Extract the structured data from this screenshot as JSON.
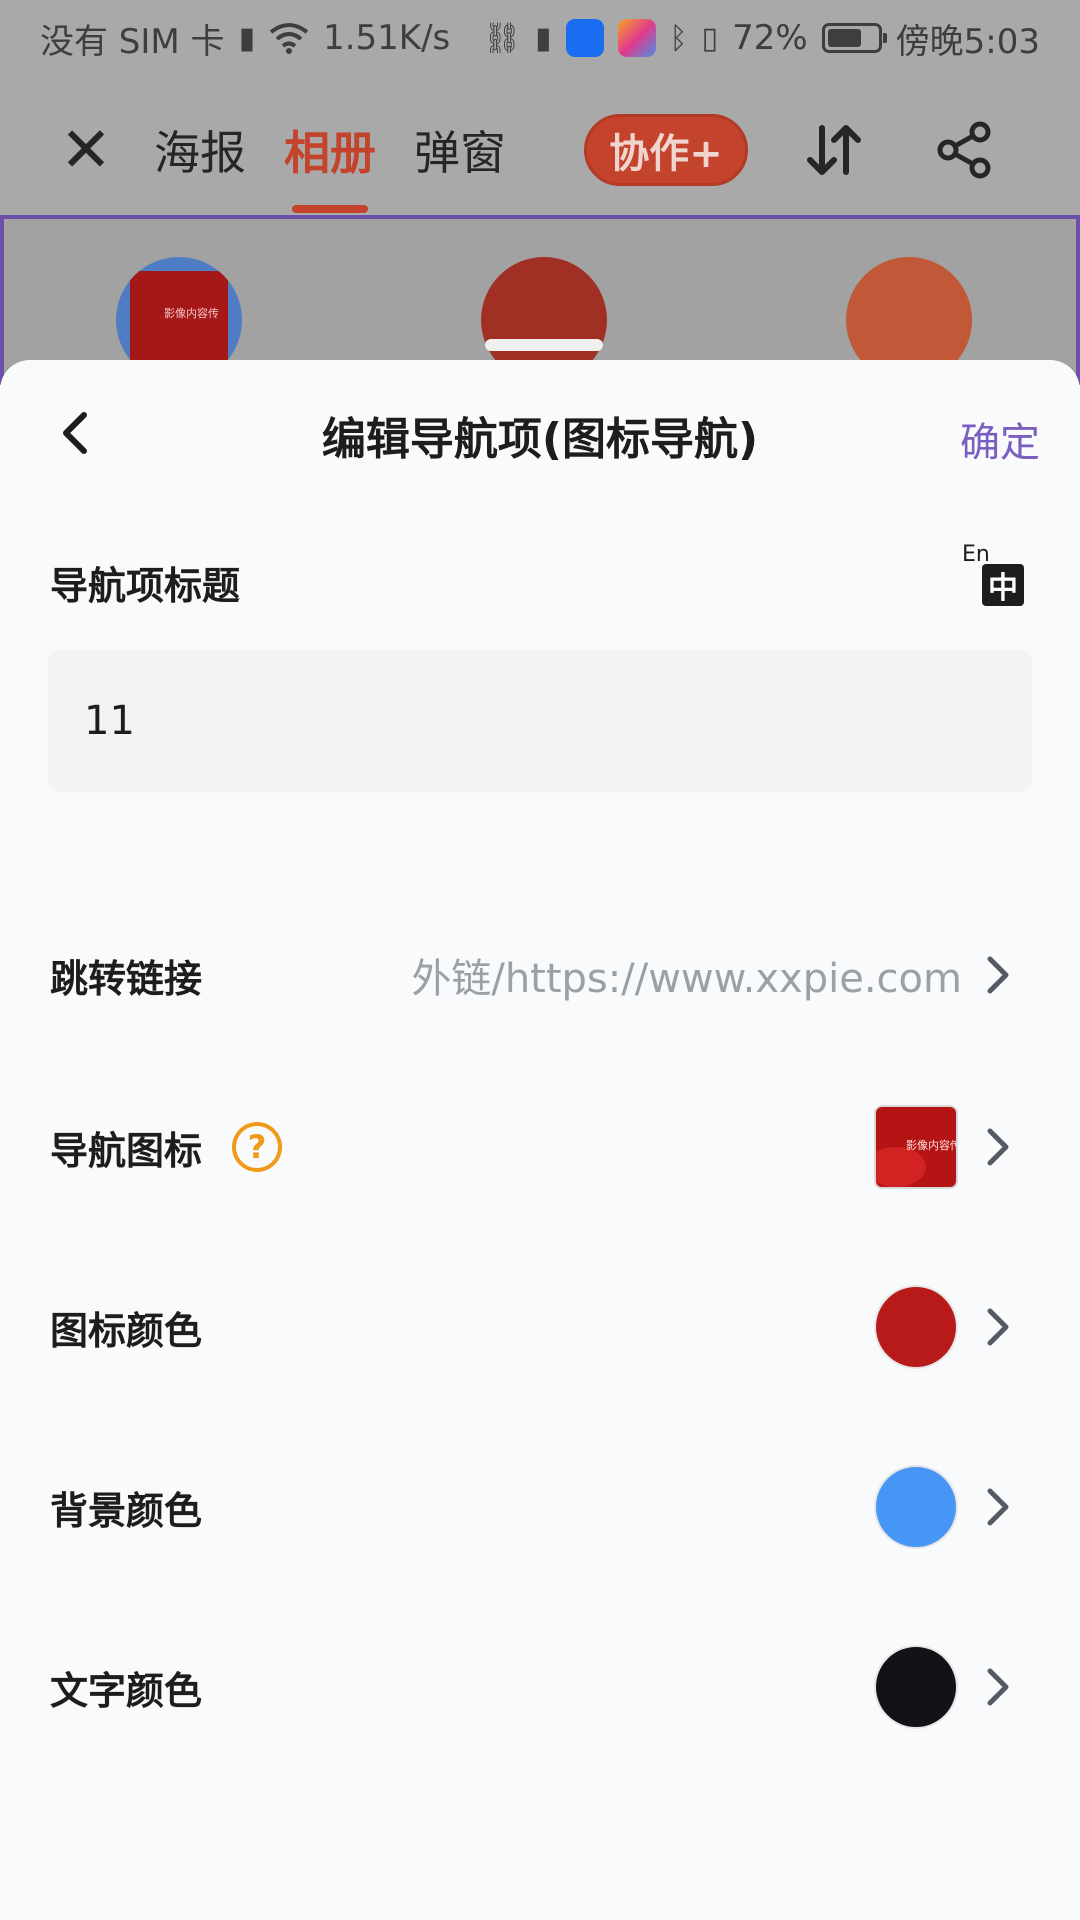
{
  "status_bar": {
    "carrier": "没有 SIM 卡",
    "speed": "1.51K/s",
    "battery_pct": "72%",
    "battery_level": 0.72,
    "time": "傍晚5:03"
  },
  "top_nav": {
    "tabs": [
      "海报",
      "相册",
      "弹窗"
    ],
    "active_tab": "相册",
    "collab_label": "协作+"
  },
  "preview": {
    "circle_colors": [
      "#4f7cc2",
      "#a03024",
      "#c15838"
    ],
    "thumb_text": "影像内容传"
  },
  "sheet": {
    "title": "编辑导航项(图标导航)",
    "confirm_label": "确定",
    "title_field": {
      "label": "导航项标题",
      "value": "11",
      "lang_en": "En",
      "lang_zh": "中"
    },
    "rows": {
      "link": {
        "label": "跳转链接",
        "value": "外链/https://www.xxpie.com"
      },
      "nav_icon": {
        "label": "导航图标",
        "help": "?",
        "thumb_text": "影像内容传"
      },
      "icon_color": {
        "label": "图标颜色",
        "color": "#b81a1a"
      },
      "bg_color": {
        "label": "背景颜色",
        "color": "#4696f5"
      },
      "text_color": {
        "label": "文字颜色",
        "color": "#121317"
      }
    }
  }
}
